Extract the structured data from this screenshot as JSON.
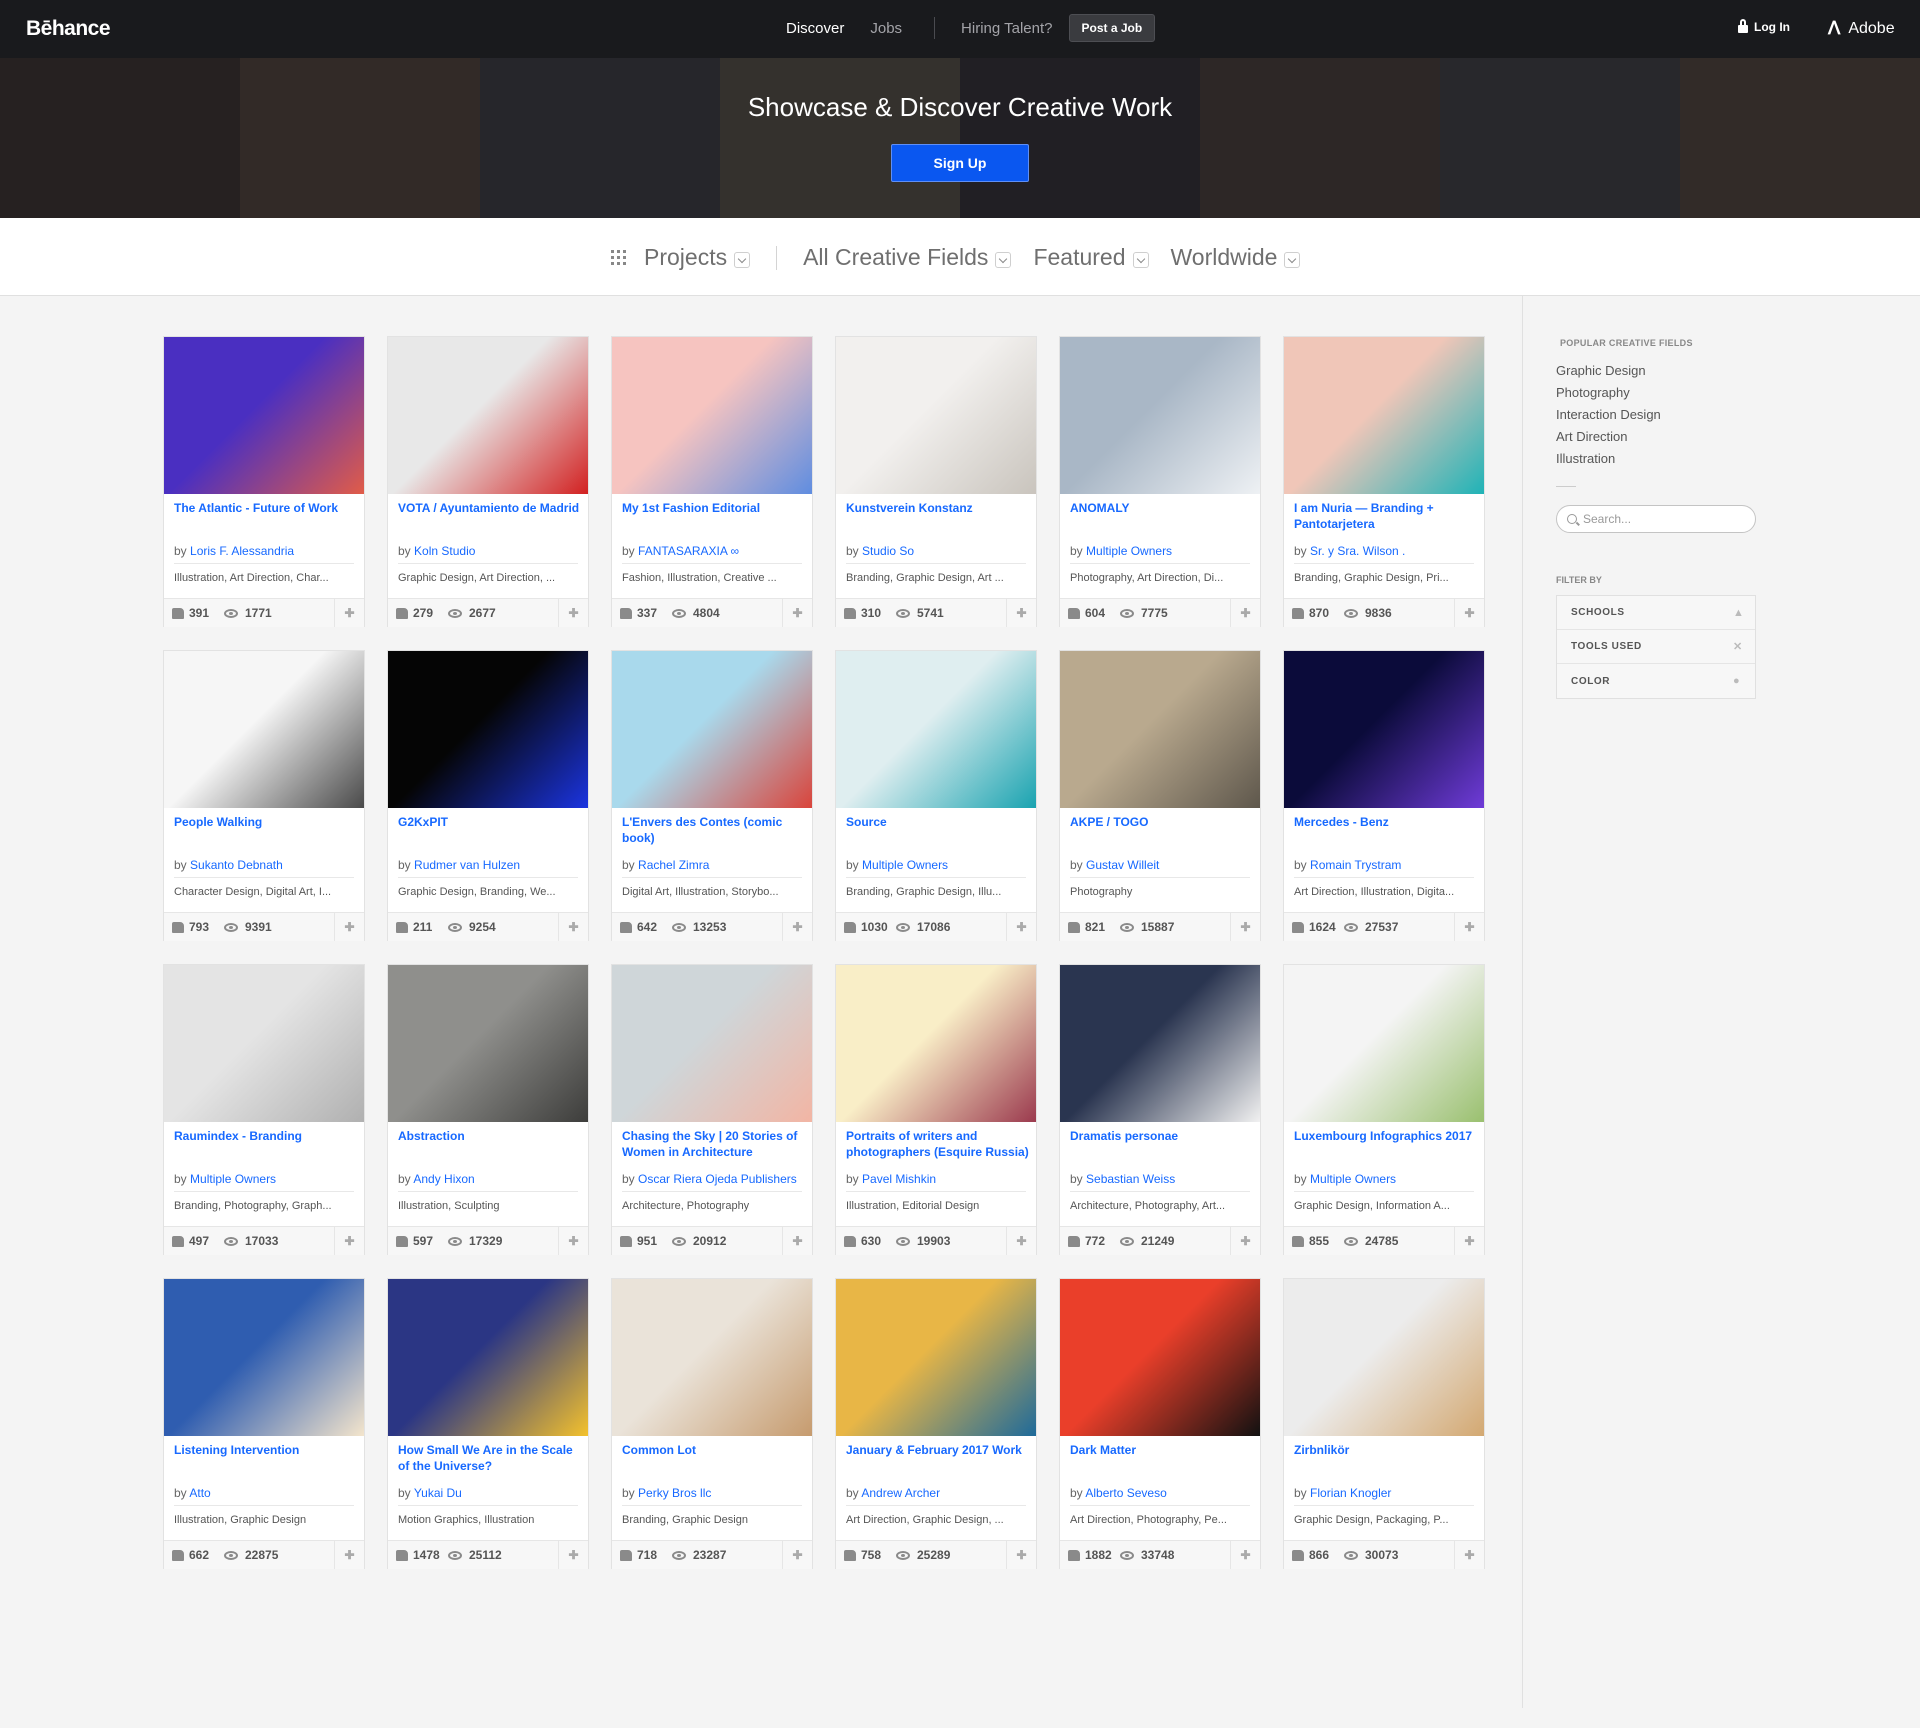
{
  "nav": {
    "logo": "Bēhance",
    "discover": "Discover",
    "jobs": "Jobs",
    "hiring": "Hiring Talent?",
    "post_job": "Post a Job",
    "login": "Log In",
    "adobe": "Adobe"
  },
  "hero": {
    "title": "Showcase & Discover Creative Work",
    "signup": "Sign Up"
  },
  "filters": {
    "projects": "Projects",
    "fields": "All Creative Fields",
    "featured": "Featured",
    "worldwide": "Worldwide"
  },
  "by_label": "by",
  "projects": [
    {
      "title": "The Atlantic - Future of Work",
      "owner": "Loris F. Alessandria",
      "fields": "Illustration, Art Direction, Char...",
      "likes": "391",
      "views": "1771",
      "thumb": [
        "#4a2fc1",
        "#e15c48"
      ]
    },
    {
      "title": "VOTA / Ayuntamiento de Madrid",
      "owner": "Koln Studio",
      "fields": "Graphic Design, Art Direction, ...",
      "likes": "279",
      "views": "2677",
      "thumb": [
        "#e8e8e8",
        "#d22121"
      ]
    },
    {
      "title": "My 1st Fashion Editorial",
      "owner": "FANTASARAXIA ∞",
      "fields": "Fashion, Illustration, Creative ...",
      "likes": "337",
      "views": "4804",
      "thumb": [
        "#f6c4c0",
        "#5f8de0"
      ]
    },
    {
      "title": "Kunstverein Konstanz",
      "owner": "Studio So",
      "fields": "Branding, Graphic Design, Art ...",
      "likes": "310",
      "views": "5741",
      "thumb": [
        "#f2f0ee",
        "#c9c4bd"
      ]
    },
    {
      "title": "ANOMALY",
      "owner": "Multiple Owners",
      "fields": "Photography, Art Direction, Di...",
      "likes": "604",
      "views": "7775",
      "thumb": [
        "#a9b7c6",
        "#eef1f4"
      ]
    },
    {
      "title": "I am Nuria — Branding + Pantotarjetera",
      "owner": "Sr. y Sra. Wilson .",
      "fields": "Branding, Graphic Design, Pri...",
      "likes": "870",
      "views": "9836",
      "thumb": [
        "#f0c6b8",
        "#1fb3b7"
      ]
    },
    {
      "title": "People Walking",
      "owner": "Sukanto Debnath",
      "fields": "Character Design, Digital Art, I...",
      "likes": "793",
      "views": "9391",
      "thumb": [
        "#f6f6f6",
        "#4a4a4a"
      ]
    },
    {
      "title": "G2KxPIT",
      "owner": "Rudmer van Hulzen",
      "fields": "Graphic Design, Branding, We...",
      "likes": "211",
      "views": "9254",
      "thumb": [
        "#050505",
        "#1b34e0"
      ]
    },
    {
      "title": "L'Envers des Contes (comic book)",
      "owner": "Rachel Zimra",
      "fields": "Digital Art, Illustration, Storybo...",
      "likes": "642",
      "views": "13253",
      "thumb": [
        "#a9d9ec",
        "#d9443b"
      ]
    },
    {
      "title": "Source",
      "owner": "Multiple Owners",
      "fields": "Branding, Graphic Design, Illu...",
      "likes": "1030",
      "views": "17086",
      "thumb": [
        "#dfeef0",
        "#1aa3b0"
      ]
    },
    {
      "title": "AKPE / TOGO",
      "owner": "Gustav Willeit",
      "fields": "Photography",
      "likes": "821",
      "views": "15887",
      "thumb": [
        "#b9a98e",
        "#5e574c"
      ]
    },
    {
      "title": "Mercedes - Benz",
      "owner": "Romain Trystram",
      "fields": "Art Direction, Illustration, Digita...",
      "likes": "1624",
      "views": "27537",
      "thumb": [
        "#0b0b3a",
        "#6f3bd8"
      ]
    },
    {
      "title": "Raumindex - Branding",
      "owner": "Multiple Owners",
      "fields": "Branding, Photography, Graph...",
      "likes": "497",
      "views": "17033",
      "thumb": [
        "#e4e4e4",
        "#b0b0b0"
      ]
    },
    {
      "title": "Abstraction",
      "owner": "Andy Hixon",
      "fields": "Illustration, Sculpting",
      "likes": "597",
      "views": "17329",
      "thumb": [
        "#8f8f8c",
        "#3d3d3b"
      ]
    },
    {
      "title": "Chasing the Sky | 20 Stories of Women in Architecture",
      "owner": "Oscar Riera Ojeda Publishers",
      "fields": "Architecture, Photography",
      "likes": "951",
      "views": "20912",
      "thumb": [
        "#cfd6d9",
        "#f2b5a4"
      ]
    },
    {
      "title": "Portraits of writers and photographers (Esquire Russia)",
      "owner": "Pavel Mishkin",
      "fields": "Illustration, Editorial Design",
      "likes": "630",
      "views": "19903",
      "thumb": [
        "#f9eec7",
        "#9b3a4e"
      ]
    },
    {
      "title": "Dramatis personae",
      "owner": "Sebastian Weiss",
      "fields": "Architecture, Photography, Art...",
      "likes": "772",
      "views": "21249",
      "thumb": [
        "#2a3550",
        "#f1f1f1"
      ]
    },
    {
      "title": "Luxembourg Infographics 2017",
      "owner": "Multiple Owners",
      "fields": "Graphic Design, Information A...",
      "likes": "855",
      "views": "24785",
      "thumb": [
        "#f4f4f4",
        "#9ac06f"
      ]
    },
    {
      "title": "Listening Intervention",
      "owner": "Atto",
      "fields": "Illustration, Graphic Design",
      "likes": "662",
      "views": "22875",
      "thumb": [
        "#2f5db0",
        "#f4e5cc"
      ]
    },
    {
      "title": "How Small We Are in the Scale of the Universe?",
      "owner": "Yukai Du",
      "fields": "Motion Graphics, Illustration",
      "likes": "1478",
      "views": "25112",
      "thumb": [
        "#2b3684",
        "#f3c12d"
      ]
    },
    {
      "title": "Common Lot",
      "owner": "Perky Bros llc",
      "fields": "Branding, Graphic Design",
      "likes": "718",
      "views": "23287",
      "thumb": [
        "#eae3d9",
        "#c69b6e"
      ]
    },
    {
      "title": "January & February 2017 Work",
      "owner": "Andrew Archer",
      "fields": "Art Direction, Graphic Design, ...",
      "likes": "758",
      "views": "25289",
      "thumb": [
        "#e8b646",
        "#1e6a9a"
      ]
    },
    {
      "title": "Dark Matter",
      "owner": "Alberto Seveso",
      "fields": "Art Direction, Photography, Pe...",
      "likes": "1882",
      "views": "33748",
      "thumb": [
        "#ea3f2a",
        "#111111"
      ]
    },
    {
      "title": "Zirbnlikör",
      "owner": "Florian Knogler",
      "fields": "Graphic Design, Packaging, P...",
      "likes": "866",
      "views": "30073",
      "thumb": [
        "#ececec",
        "#d3a871"
      ]
    }
  ],
  "sidebar": {
    "heading": "POPULAR CREATIVE FIELDS",
    "fields": [
      "Graphic Design",
      "Photography",
      "Interaction Design",
      "Art Direction",
      "Illustration"
    ],
    "search_placeholder": "Search...",
    "filter_by": "FILTER BY",
    "filters": [
      "SCHOOLS",
      "TOOLS USED",
      "COLOR"
    ]
  }
}
